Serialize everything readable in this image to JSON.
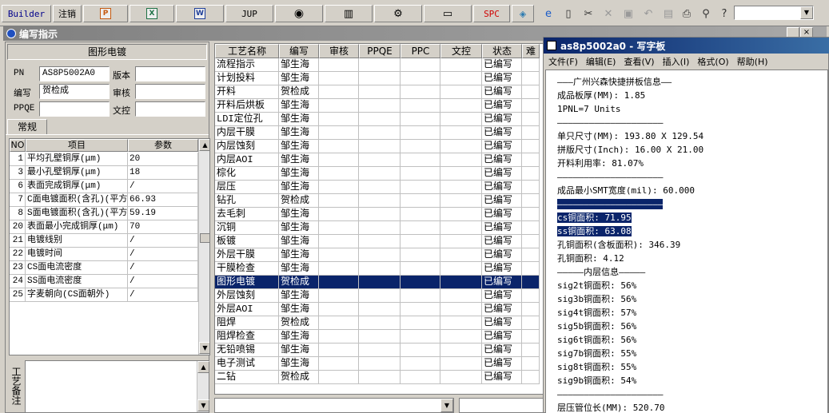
{
  "toolbar": {
    "builder": "Builder",
    "cancel": "注销",
    "jup": "JUP",
    "spc": "SPC"
  },
  "window": {
    "title": "编写指示"
  },
  "left": {
    "section_title": "图形电镀",
    "labels": {
      "pn": "PN",
      "version": "版本",
      "author": "编写",
      "review": "审核",
      "ppqe": "PPQE",
      "doc_control": "文控"
    },
    "values": {
      "pn": "AS8P5002A0",
      "version": "",
      "author": "贺检成",
      "review": "",
      "ppqe": "",
      "doc_control": ""
    },
    "tab": "常规",
    "params_headers": [
      "NO",
      "项目",
      "参数"
    ],
    "params": [
      {
        "no": "1",
        "item": "平均孔壁铜厚(μm)",
        "value": "20"
      },
      {
        "no": "3",
        "item": "最小孔壁铜厚(μm)",
        "value": "18"
      },
      {
        "no": "6",
        "item": "表面完成铜厚(μm)",
        "value": "/"
      },
      {
        "no": "7",
        "item": "C面电镀面积(含孔)(平方",
        "value": "66.93"
      },
      {
        "no": "8",
        "item": "S面电镀面积(含孔)(平方",
        "value": "59.19"
      },
      {
        "no": "20",
        "item": "表面最小完成铜厚(μm)",
        "value": "70"
      },
      {
        "no": "21",
        "item": "电镀线别",
        "value": "/"
      },
      {
        "no": "22",
        "item": "电镀时间",
        "value": "/"
      },
      {
        "no": "23",
        "item": "CS面电流密度",
        "value": "/"
      },
      {
        "no": "24",
        "item": "SS面电流密度",
        "value": "/"
      },
      {
        "no": "25",
        "item": "字麦朝向(CS面朝外)",
        "value": "/"
      }
    ],
    "notes_label": "工艺备注"
  },
  "process_table": {
    "headers": [
      "工艺名称",
      "编写",
      "审核",
      "PPQE",
      "PPC",
      "文控",
      "状态",
      "难"
    ],
    "rows": [
      [
        "流程指示",
        "邹生海",
        "已编写"
      ],
      [
        "计划投料",
        "邹生海",
        "已编写"
      ],
      [
        "开料",
        "贺检成",
        "已编写"
      ],
      [
        "开料后烘板",
        "邹生海",
        "已编写"
      ],
      [
        "LDI定位孔",
        "邹生海",
        "已编写"
      ],
      [
        "内层干膜",
        "邹生海",
        "已编写"
      ],
      [
        "内层蚀刻",
        "邹生海",
        "已编写"
      ],
      [
        "内层AOI",
        "邹生海",
        "已编写"
      ],
      [
        "棕化",
        "邹生海",
        "已编写"
      ],
      [
        "层压",
        "邹生海",
        "已编写"
      ],
      [
        "钻孔",
        "贺检成",
        "已编写"
      ],
      [
        "去毛刺",
        "邹生海",
        "已编写"
      ],
      [
        "沉铜",
        "邹生海",
        "已编写"
      ],
      [
        "板镀",
        "邹生海",
        "已编写"
      ],
      [
        "外层干膜",
        "邹生海",
        "已编写"
      ],
      [
        "干膜检查",
        "邹生海",
        "已编写"
      ],
      [
        "图形电镀",
        "贺检成",
        "已编写"
      ],
      [
        "外层蚀刻",
        "邹生海",
        "已编写"
      ],
      [
        "外层AOI",
        "邹生海",
        "已编写"
      ],
      [
        "阻焊",
        "贺检成",
        "已编写"
      ],
      [
        "阻焊检查",
        "邹生海",
        "已编写"
      ],
      [
        "无铅喷锡",
        "邹生海",
        "已编写"
      ],
      [
        "电子测试",
        "邹生海",
        "已编写"
      ],
      [
        "二钻",
        "贺检成",
        "已编写"
      ]
    ],
    "selected_index": 16
  },
  "notepad": {
    "title": "as8p5002a0 - 写字板",
    "menu": [
      "文件(F)",
      "编辑(E)",
      "查看(V)",
      "插入(I)",
      "格式(O)",
      "帮助(H)"
    ],
    "lines": [
      "———广州兴森快捷拼板信息——",
      "成品板厚(MM): 1.85",
      "1PNL=7 Units",
      "————————————————————",
      "单只尺寸(MM): 193.80 X 129.54",
      "拼版尺寸(Inch): 16.00 X 21.00",
      "开料利用率: 81.07%",
      "————————————————————",
      "成品最小SMT宽度(mil): 60.000",
      "————————————————————",
      "cs铜面积: 71.95",
      "ss铜面积: 63.08",
      "孔铜面积(含板面积): 346.39",
      "孔铜面积: 4.12",
      "—————内层信息—————",
      "sig2t铜面积: 56%",
      "sig3b铜面积: 56%",
      "sig4t铜面积: 57%",
      "sig5b铜面积: 56%",
      "sig6t铜面积: 56%",
      "sig7b铜面积: 55%",
      "sig8t铜面积: 55%",
      "sig9b铜面积: 54%",
      "————————————————————",
      "层压管位长(MM): 520.70"
    ],
    "highlighted_lines": [
      9,
      10,
      11
    ]
  }
}
